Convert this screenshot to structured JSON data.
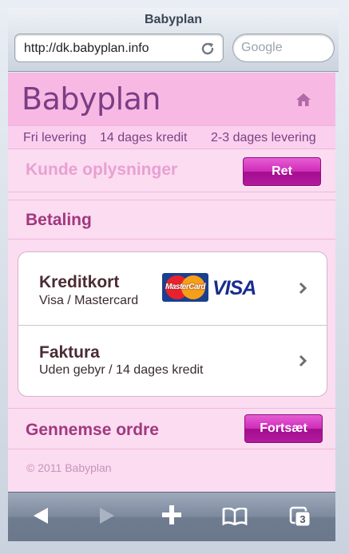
{
  "browser": {
    "title": "Babyplan",
    "url": "http://dk.babyplan.info",
    "search_placeholder": "Google",
    "tab_count": "3"
  },
  "header": {
    "brand": "Babyplan"
  },
  "perks": [
    "Fri levering",
    "14 dages kredit",
    "2-3 dages levering"
  ],
  "customer_section": {
    "title": "Kunde oplysninger",
    "button": "Ret"
  },
  "payment_section": {
    "title": "Betaling",
    "options": [
      {
        "title": "Kreditkort",
        "subtitle": "Visa / Mastercard",
        "logos": [
          "MasterCard",
          "VISA"
        ]
      },
      {
        "title": "Faktura",
        "subtitle": "Uden gebyr / 14 dages kredit"
      }
    ]
  },
  "review_section": {
    "title": "Gennemse ordre",
    "button": "Fortsæt"
  },
  "footer": {
    "copyright": "© 2011 Babyplan"
  },
  "toolbar": {
    "icons": [
      "back-arrow-icon",
      "forward-arrow-icon",
      "plus-icon",
      "bookmarks-icon",
      "tabs-icon"
    ]
  },
  "colors": {
    "brand_purple": "#7a3e85",
    "section_title_light": "#e8a0d2",
    "section_title_dark": "#a0387f",
    "button_magenta": "#cf2ab8",
    "page_pink": "#fbdcf1",
    "header_pink": "#f7b9e3"
  }
}
